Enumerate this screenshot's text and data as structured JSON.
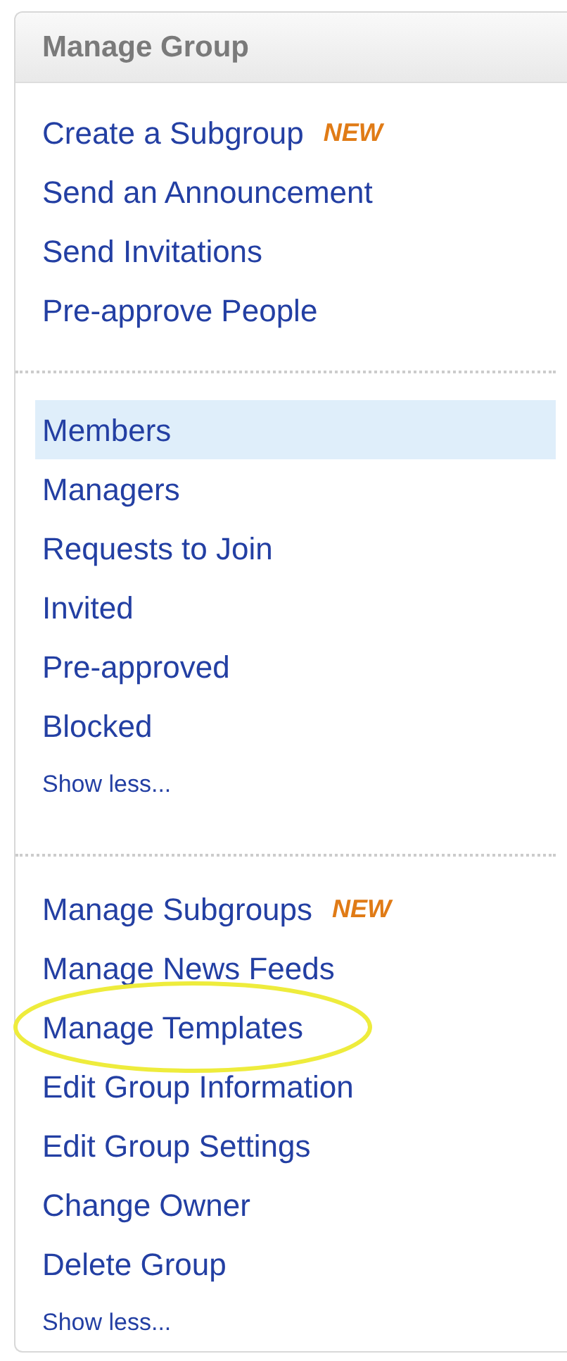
{
  "panel": {
    "title": "Manage Group"
  },
  "sections": [
    {
      "items": [
        {
          "label": "Create a Subgroup",
          "badge": "NEW",
          "selected": false,
          "circled": false
        },
        {
          "label": "Send an Announcement",
          "selected": false,
          "circled": false
        },
        {
          "label": "Send Invitations",
          "selected": false,
          "circled": false
        },
        {
          "label": "Pre-approve People",
          "selected": false,
          "circled": false
        }
      ]
    },
    {
      "items": [
        {
          "label": "Members",
          "selected": true,
          "circled": false
        },
        {
          "label": "Managers",
          "selected": false,
          "circled": false
        },
        {
          "label": "Requests to Join",
          "selected": false,
          "circled": false
        },
        {
          "label": "Invited",
          "selected": false,
          "circled": false
        },
        {
          "label": "Pre-approved",
          "selected": false,
          "circled": false
        },
        {
          "label": "Blocked",
          "selected": false,
          "circled": false
        }
      ],
      "toggle": "Show less..."
    },
    {
      "items": [
        {
          "label": "Manage Subgroups",
          "badge": "NEW",
          "selected": false,
          "circled": false
        },
        {
          "label": "Manage News Feeds",
          "selected": false,
          "circled": false
        },
        {
          "label": "Manage Templates",
          "selected": false,
          "circled": true
        },
        {
          "label": "Edit Group Information",
          "selected": false,
          "circled": false
        },
        {
          "label": "Edit Group Settings",
          "selected": false,
          "circled": false
        },
        {
          "label": "Change Owner",
          "selected": false,
          "circled": false
        },
        {
          "label": "Delete Group",
          "selected": false,
          "circled": false
        }
      ],
      "toggle": "Show less..."
    }
  ]
}
